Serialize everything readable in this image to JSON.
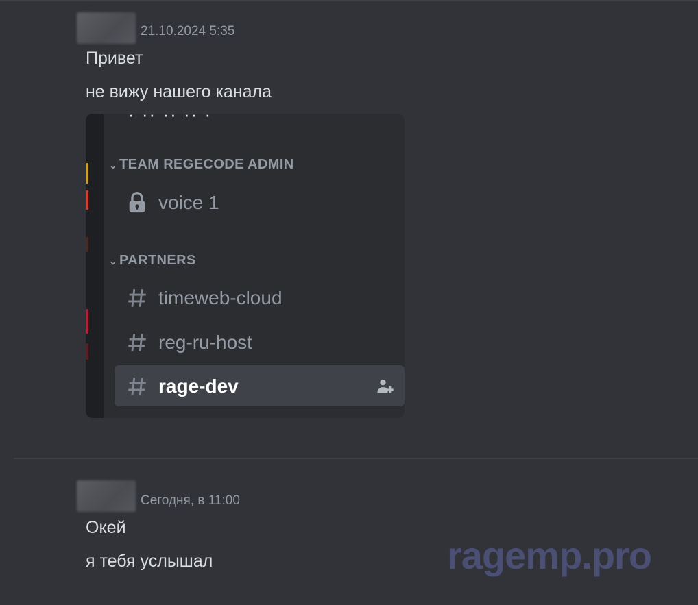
{
  "messages": [
    {
      "timestamp": "21.10.2024 5:35",
      "lines": [
        "Привет",
        "не вижу нашего канала"
      ]
    },
    {
      "timestamp": "Сегодня, в 11:00",
      "lines": [
        "Окей",
        "я тебя услышал"
      ]
    }
  ],
  "attachment": {
    "categories": [
      {
        "name": "TEAM REGECODE ADMIN",
        "icon": "chevron-down-icon"
      },
      {
        "name": "PARTNERS",
        "icon": "chevron-down-icon"
      }
    ],
    "channels": [
      {
        "name": "voice 1",
        "icon": "lock-icon",
        "active": false
      },
      {
        "name": "timeweb-cloud",
        "icon": "hash-icon",
        "active": false
      },
      {
        "name": "reg-ru-host",
        "icon": "hash-icon",
        "active": false
      },
      {
        "name": "rage-dev",
        "icon": "hash-icon",
        "active": true,
        "extra_icon": "add-member-icon"
      }
    ]
  },
  "watermark": "ragemp.pro",
  "colors": {
    "background": "#313338",
    "text": "#dbdee1",
    "muted": "#949ba4",
    "active_channel_bg": "#404249",
    "watermark": "#4b4f73"
  }
}
